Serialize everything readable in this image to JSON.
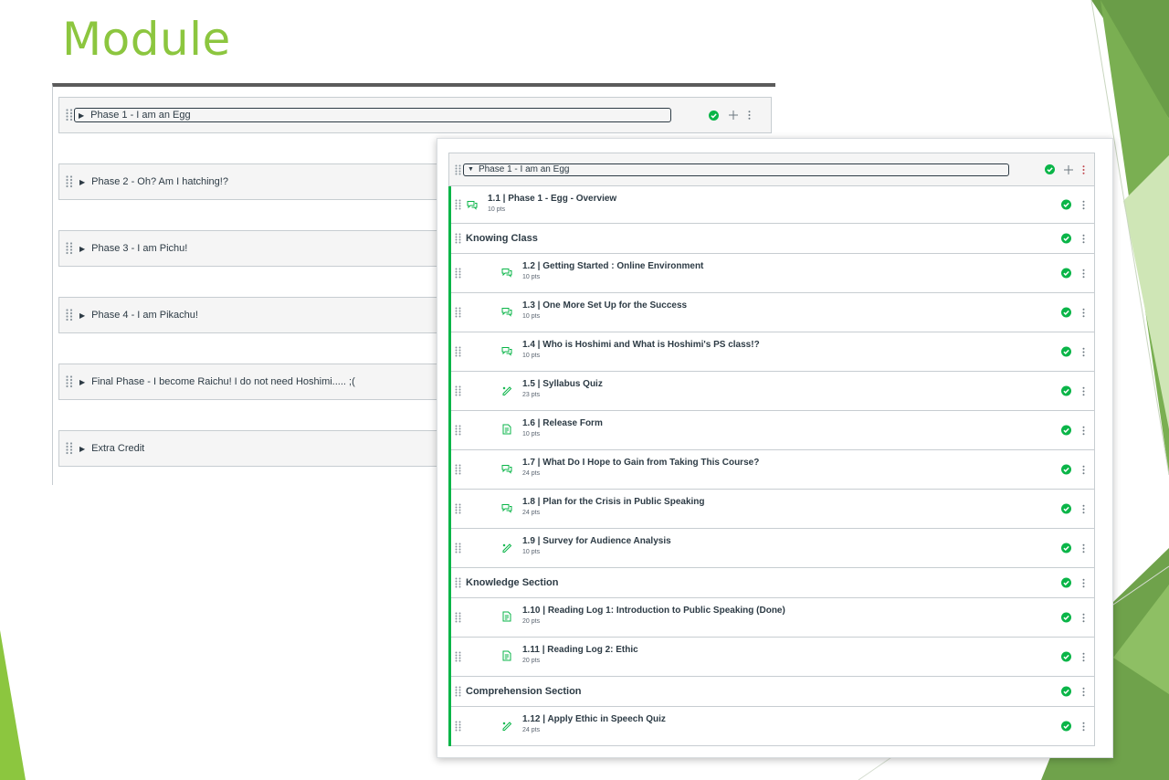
{
  "slide": {
    "title": "Module",
    "accent_color": "#8cc63f",
    "accent_dark": "#5b9b36"
  },
  "left_panel": {
    "modules": [
      {
        "title": "Phase 1 - I am an Egg",
        "state": "collapsed",
        "focused": true
      },
      {
        "title": "Phase 2 - Oh? Am I hatching!?",
        "state": "collapsed"
      },
      {
        "title": "Phase 3 - I am Pichu!",
        "state": "collapsed"
      },
      {
        "title": "Phase 4 - I am Pikachu!",
        "state": "collapsed"
      },
      {
        "title": "Final Phase - I become Raichu! I do not need Hoshimi..... ;(",
        "state": "collapsed"
      },
      {
        "title": "Extra Credit",
        "state": "collapsed"
      }
    ]
  },
  "right_panel": {
    "module_title": "Phase 1 - I am an Egg",
    "published_color": "#0ab548",
    "rows": [
      {
        "kind": "item",
        "title": "1.1 | Phase 1 - Egg - Overview",
        "pts": "10 pts",
        "icon": "discussion-icon",
        "indent": 0
      },
      {
        "kind": "header",
        "title": "Knowing Class"
      },
      {
        "kind": "item",
        "title": "1.2 | Getting Started : Online Environment",
        "pts": "10 pts",
        "icon": "discussion-icon",
        "indent": 1
      },
      {
        "kind": "item",
        "title": "1.3 | One More Set Up for the Success",
        "pts": "10 pts",
        "icon": "discussion-icon",
        "indent": 1
      },
      {
        "kind": "item",
        "title": "1.4 | Who is Hoshimi and What is Hoshimi's PS class!?",
        "pts": "10 pts",
        "icon": "discussion-icon",
        "indent": 1
      },
      {
        "kind": "item",
        "title": "1.5 | Syllabus Quiz",
        "pts": "23 pts",
        "icon": "quiz-icon",
        "indent": 1
      },
      {
        "kind": "item",
        "title": "1.6 | Release Form",
        "pts": "10 pts",
        "icon": "assignment-icon",
        "indent": 1
      },
      {
        "kind": "item",
        "title": "1.7 | What Do I Hope to Gain from Taking This Course?",
        "pts": "24 pts",
        "icon": "discussion-icon",
        "indent": 1
      },
      {
        "kind": "item",
        "title": "1.8 | Plan for the Crisis in Public Speaking",
        "pts": "24 pts",
        "icon": "discussion-icon",
        "indent": 1
      },
      {
        "kind": "item",
        "title": "1.9 | Survey for Audience Analysis",
        "pts": "10 pts",
        "icon": "quiz-icon",
        "indent": 1
      },
      {
        "kind": "header",
        "title": "Knowledge Section"
      },
      {
        "kind": "item",
        "title": "1.10 | Reading Log 1: Introduction to Public Speaking (Done)",
        "pts": "20 pts",
        "icon": "assignment-icon",
        "indent": 1
      },
      {
        "kind": "item",
        "title": "1.11 | Reading Log 2: Ethic",
        "pts": "20 pts",
        "icon": "assignment-icon",
        "indent": 1
      },
      {
        "kind": "header",
        "title": "Comprehension Section"
      },
      {
        "kind": "item",
        "title": "1.12 | Apply Ethic in Speech Quiz",
        "pts": "24 pts",
        "icon": "quiz-icon",
        "indent": 1
      }
    ]
  }
}
